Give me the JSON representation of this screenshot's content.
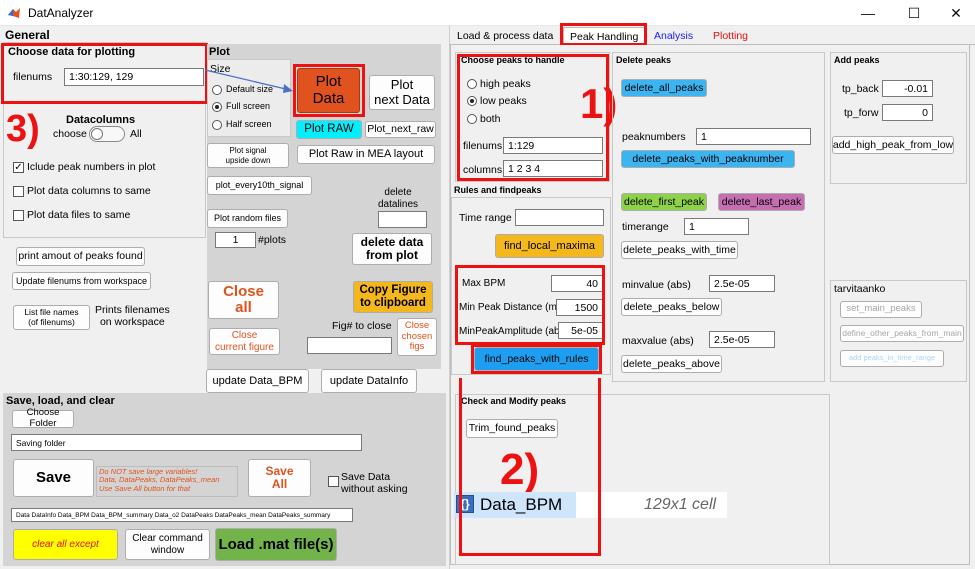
{
  "window": {
    "title": "DatAnalyzer",
    "minimize": "—",
    "maximize": "☐",
    "close": "✕"
  },
  "left": {
    "general_title": "General",
    "choose_data": {
      "title": "Choose data for plotting",
      "filenums_label": "filenums",
      "filenums_value": "1:30:129, 129"
    },
    "datacolumns": {
      "title": "Datacolumns",
      "choose_label": "choose",
      "all_label": "All",
      "include_peaks_label": "Iclude peak numbers in plot",
      "include_peaks_checked": true,
      "same_columns_label": "Plot data columns to same",
      "same_files_label": "Plot data files to same"
    },
    "buttons": {
      "print_peaks": "print amout of peaks found",
      "update_filenums": "Update filenums from workspace",
      "list_file_names": "List file names\n(of filenums)",
      "prints_filenames": "Prints filenames\non workspace"
    },
    "plot": {
      "title": "Plot",
      "size_label": "Size",
      "size_options": [
        "Default size",
        "Full screen",
        "Half screen"
      ],
      "size_selected": 1,
      "plot_data": "Plot\nData",
      "plot_next_data": "Plot\nnext Data",
      "plot_raw": "Plot RAW",
      "plot_next_raw": "Plot_next_raw",
      "plot_signal_upside_down": "Plot signal\nupside down",
      "plot_raw_mea": "Plot Raw in MEA layout",
      "plot_every_10th": "plot_every10th_signal",
      "delete_datalines_label": "delete\ndatalines",
      "plot_random_files": "Plot random files",
      "num_plots_value": "1",
      "num_plots_label": "#plots",
      "delete_from_plot": "delete data\nfrom plot",
      "close_all": "Close\nall",
      "copy_figure": "Copy Figure\nto clipboard",
      "close_current": "Close\ncurrent figure",
      "fig_to_close_label": "Fig# to close",
      "close_chosen": "Close\nchosen\nfigs",
      "update_data_bpm": "update Data_BPM",
      "update_datainfo": "update DataInfo"
    },
    "save": {
      "title": "Save, load, and clear",
      "choose_folder": "Choose Folder",
      "saving_folder": "Saving folder",
      "save": "Save",
      "warning": "Do NOT save large variables!\nData, DataPeaks, DataPeaks_mean\nUse Save All button for that",
      "save_all": "Save\nAll",
      "save_without_asking": "Save Data\nwithout asking",
      "variables": "Data DataInfo Data_BPM Data_BPM_summary Data_o2 DataPeaks DataPeaks_mean DataPeaks_summary",
      "clear_all_except": "clear all except",
      "clear_command_window": "Clear command\nwindow",
      "load_mat": "Load .mat file(s)"
    }
  },
  "right": {
    "tabs": [
      {
        "label": "Load & process data",
        "color": "#000000"
      },
      {
        "label": "Peak Handling",
        "color": "#000000"
      },
      {
        "label": "Analysis",
        "color": "#1a1aff"
      },
      {
        "label": "Plotting",
        "color": "#e01010"
      }
    ],
    "choose_peaks": {
      "title": "Choose peaks to handle",
      "options": [
        "high peaks",
        "low peaks",
        "both"
      ],
      "selected": 1,
      "filenums_label": "filenums",
      "filenums_value": "1:129",
      "columns_label": "columns",
      "columns_value": "1  2  3  4"
    },
    "rules": {
      "title": "Rules and findpeaks",
      "time_range_label": "Time range",
      "find_local_maxima": "find_local_maxima",
      "max_bpm_label": "Max BPM",
      "max_bpm_value": "40",
      "min_peak_distance_label": "Min Peak Distance (ms)",
      "min_peak_distance_value": "1500",
      "min_peak_amplitude_label": "MinPeakAmplitude (abs)",
      "min_peak_amplitude_value": "5e-05",
      "find_peaks_with_rules": "find_peaks_with_rules"
    },
    "delete_peaks": {
      "title": "Delete peaks",
      "delete_all_peaks": "delete_all_peaks",
      "peaknumbers_label": "peaknumbers",
      "peaknumbers_value": "1",
      "delete_with_peaknumber": "delete_peaks_with_peaknumber",
      "delete_first_peak": "delete_first_peak",
      "delete_last_peak": "delete_last_peak",
      "timerange_label": "timerange",
      "timerange_value": "1",
      "delete_with_time": "delete_peaks_with_time",
      "minvalue_label": "minvalue (abs)",
      "minvalue_value": "2.5e-05",
      "delete_below": "delete_peaks_below",
      "maxvalue_label": "maxvalue (abs)",
      "maxvalue_value": "2.5e-05",
      "delete_above": "delete_peaks_above"
    },
    "add_peaks": {
      "title": "Add peaks",
      "tp_back_label": "tp_back",
      "tp_back_value": "-0.01",
      "tp_forw_label": "tp_forw",
      "tp_forw_value": "0",
      "add_high_peak_from_low": "add_high_peak_from_low"
    },
    "tarvitaanko": {
      "title": "tarvitaanko",
      "set_main_peaks": "set_main_peaks",
      "define_other_peaks": "define_other_peaks_from_main",
      "add_peaks_in_time_range": "add peaks_in_time_range"
    },
    "check_modify": {
      "title": "Check and Modify peaks",
      "trim_found_peaks": "Trim_found_peaks"
    },
    "workspace_var": {
      "name": "Data_BPM",
      "value": "129x1 cell"
    }
  },
  "annotations": {
    "mark_1": "1)",
    "mark_2": "2)",
    "mark_3": "3)"
  },
  "colors": {
    "plot_data_bg": "#e0531f",
    "plot_raw_bg": "#00f0ff",
    "close_all_text": "#e0531f",
    "copy_figure_bg": "#f5b81c",
    "delete_blue_bg": "#3bb4f2",
    "delete_green_bg": "#8ed24c",
    "delete_purple_bg": "#c56fb2",
    "find_local_maxima_bg": "#f5b81c",
    "find_peaks_rules_bg": "#1d9ef0",
    "clear_all_bg": "#ffff00",
    "load_mat_bg": "#72b34a",
    "annotation_red": "#ee1111"
  }
}
